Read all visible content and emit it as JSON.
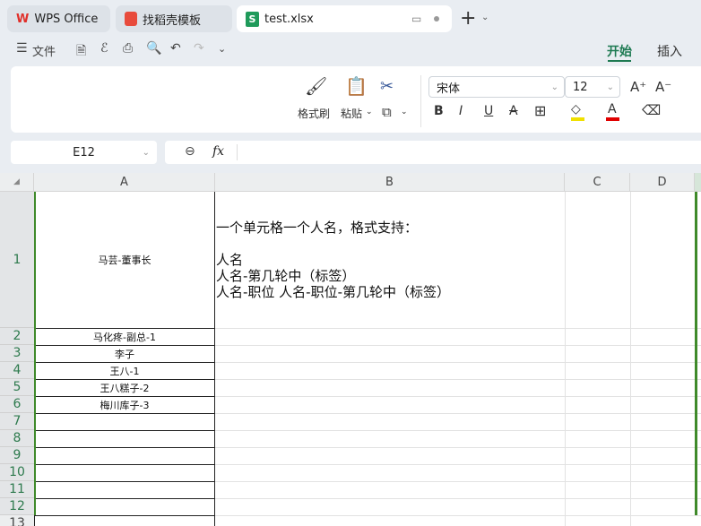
{
  "tabs": [
    {
      "label": "WPS Office",
      "icon": "wps-logo-icon"
    },
    {
      "label": "找稻壳模板",
      "icon": "docer-icon"
    },
    {
      "label": "test.xlsx",
      "icon": "spreadsheet-icon",
      "active": true
    }
  ],
  "toolbar": {
    "file_label": "文件",
    "ribbon_tabs": [
      "开始",
      "插入"
    ],
    "active_tab": "开始"
  },
  "ribbon": {
    "format_painter": "格式刷",
    "paste": "粘贴",
    "font_name": "宋体",
    "font_size": "12",
    "bold": "B",
    "italic": "I",
    "underline": "U",
    "strike": "A",
    "highlight_color": "#f0e000",
    "font_color": "#e00000"
  },
  "formula_bar": {
    "name_box": "E12",
    "fx": "fx",
    "value": ""
  },
  "sheet": {
    "columns": [
      "A",
      "B",
      "C",
      "D"
    ],
    "rows": [
      "1",
      "2",
      "3",
      "4",
      "5",
      "6",
      "7",
      "8",
      "9",
      "10",
      "11",
      "12",
      "13"
    ],
    "A": [
      "马芸-董事长",
      "马化疼-副总-1",
      "李子",
      "王八-1",
      "王八糕子-2",
      "梅川库子-3"
    ],
    "B1": [
      "一个单元格一个人名，格式支持：",
      "",
      "人名",
      "人名-第几轮中（标签）",
      "人名-职位 人名-职位-第几轮中（标签）"
    ]
  },
  "accent": "#1e7a52"
}
